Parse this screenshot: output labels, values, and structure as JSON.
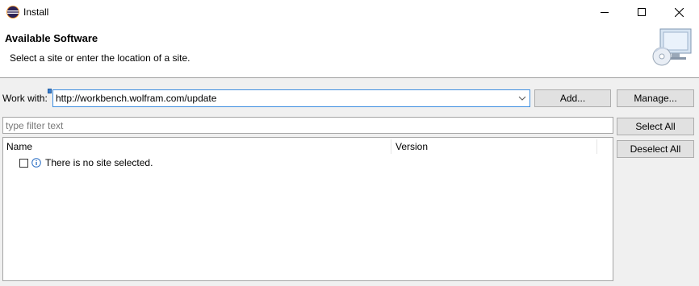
{
  "window": {
    "title": "Install",
    "controls": {
      "minimize": "minimize-icon",
      "maximize": "maximize-icon",
      "close": "close-icon"
    }
  },
  "header": {
    "title": "Available Software",
    "description": "Select a site or enter the location of a site.",
    "icon": "install-wizard-icon"
  },
  "work_with": {
    "label": "Work with:",
    "value": "http://workbench.wolfram.com/update"
  },
  "buttons": {
    "add": "Add...",
    "manage": "Manage...",
    "select_all": "Select All",
    "deselect_all": "Deselect All"
  },
  "filter": {
    "placeholder": "type filter text",
    "value": ""
  },
  "table": {
    "columns": [
      "Name",
      "Version"
    ],
    "rows": [
      {
        "checked": false,
        "icon": "info-icon",
        "name": "There is no site selected."
      }
    ]
  },
  "colors": {
    "focus_border": "#3e8ee0",
    "header_bg": "#ffffff",
    "dialog_bg": "#f0f0f0"
  }
}
